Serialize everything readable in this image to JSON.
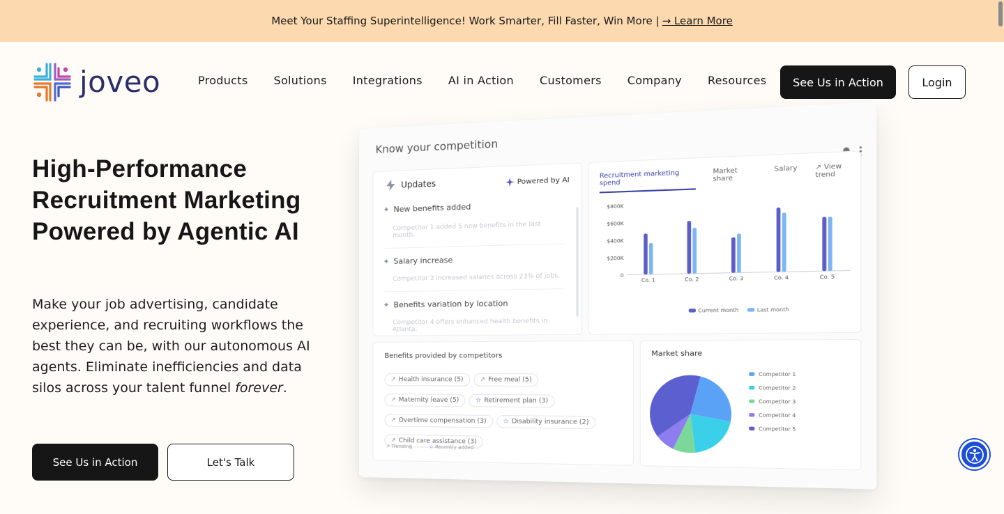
{
  "banner": {
    "text": "Meet Your Staffing Superintelligence! Work Smarter, Fill Faster, Win More |",
    "link": "→ Learn More",
    "bg": "#fcd9ae"
  },
  "nav": {
    "logo_text": "joveo",
    "items": [
      "Products",
      "Solutions",
      "Integrations",
      "AI in Action",
      "Customers",
      "Company",
      "Resources"
    ],
    "cta": "See Us in Action",
    "login": "Login"
  },
  "hero": {
    "title": "High-Performance Recruitment Marketing Powered by Agentic AI",
    "subtitle_pre": "Make your job advertising, candidate experience, and recruiting workflows the best they can be, with our autonomous AI agents. Eliminate inefficiencies and data silos across your talent funnel ",
    "subtitle_em": "forever",
    "subtitle_post": ".",
    "primary_button": "See Us in Action",
    "secondary_button": "Let's Talk"
  },
  "dashboard": {
    "title": "Know your competition",
    "updates": {
      "heading": "Updates",
      "powered": "Powered by AI",
      "items": [
        {
          "title": "New benefits added",
          "detail": "Competitor 1 added 5 new benefits in the last month."
        },
        {
          "title": "Salary increase",
          "detail": "Competitor 3 increased salaries across 23% of jobs."
        },
        {
          "title": "Benefits variation by location",
          "detail": "Competitor 4 offers enhanced health benefits in Atlanta."
        }
      ]
    },
    "tabs": [
      "Recruitment marketing spend",
      "Market share",
      "Salary"
    ],
    "view_trend": "View trend",
    "benefits": {
      "heading": "Benefits provided by competitors",
      "chips": [
        {
          "label": "Health insurance (5)",
          "icon": "trending-icon"
        },
        {
          "label": "Free meal (5)",
          "icon": "trending-icon"
        },
        {
          "label": "Maternity leave (5)",
          "icon": "trending-icon"
        },
        {
          "label": "Retirement plan (3)",
          "icon": "star-icon"
        },
        {
          "label": "Overtime compensation (3)",
          "icon": "trending-icon"
        },
        {
          "label": "Disability insurance (2)",
          "icon": "star-icon"
        },
        {
          "label": "Child care assistance (3)",
          "icon": "trending-icon"
        }
      ],
      "legend_trending": "Trending",
      "legend_recent": "Recently added"
    },
    "market_share_heading": "Market share"
  },
  "chart_data": [
    {
      "type": "bar",
      "title": "Recruitment marketing spend",
      "categories": [
        "Co. 1",
        "Co. 2",
        "Co. 3",
        "Co. 4",
        "Co. 5"
      ],
      "y_ticks": [
        "0",
        "$200K",
        "$400K",
        "$600K",
        "$800K"
      ],
      "ylim": [
        0,
        800000
      ],
      "series": [
        {
          "name": "Current month",
          "values": [
            470000,
            600000,
            400000,
            720000,
            600000
          ],
          "color": "#5b5fc7"
        },
        {
          "name": "Last month",
          "values": [
            360000,
            520000,
            440000,
            660000,
            600000
          ],
          "color": "#7cb6f5"
        }
      ],
      "legend_position": "bottom"
    },
    {
      "type": "pie",
      "title": "Market share",
      "labels": [
        "Competitor 1",
        "Competitor 2",
        "Competitor 3",
        "Competitor 4",
        "Competitor 5"
      ],
      "values": [
        24,
        20,
        9,
        8,
        39
      ],
      "colors": [
        "#5aa2f5",
        "#3bd0ea",
        "#7cd89a",
        "#8d7df0",
        "#5b5fd0"
      ],
      "legend_position": "right"
    }
  ]
}
